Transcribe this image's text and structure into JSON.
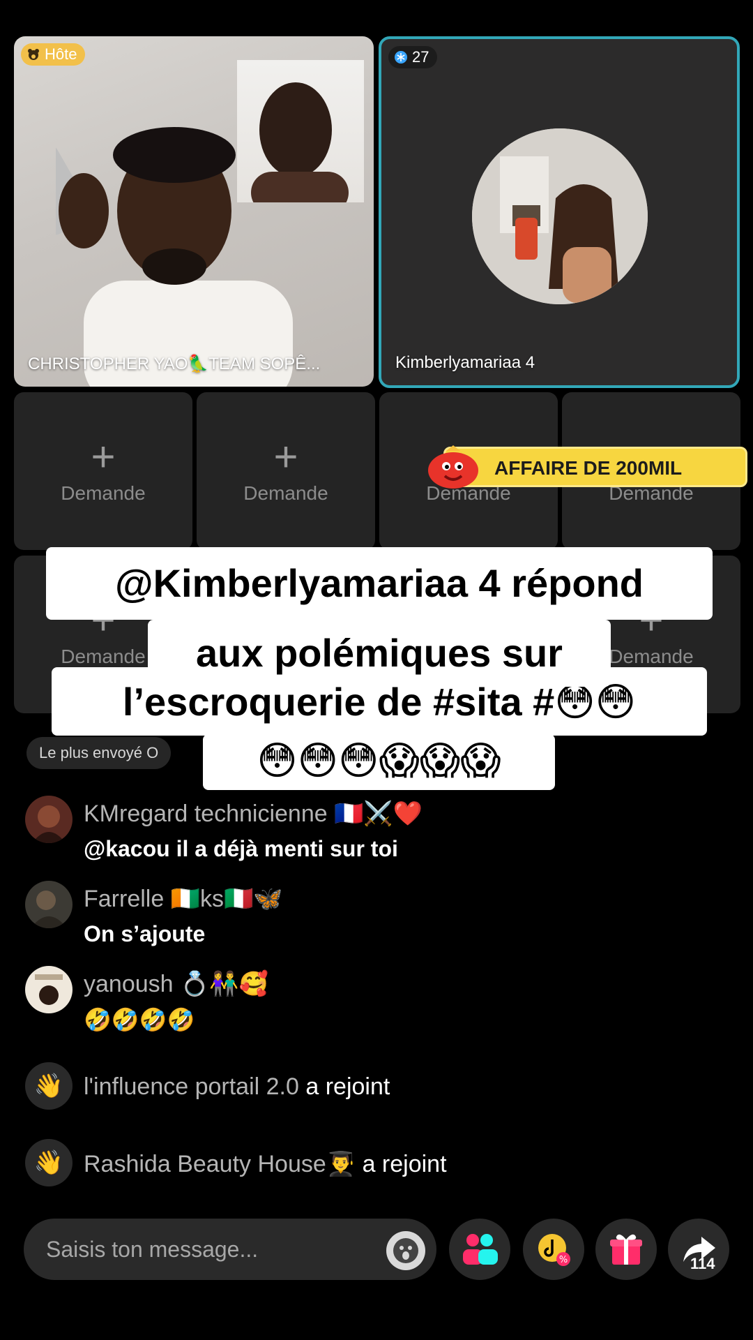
{
  "host_tile": {
    "badge": "Hôte",
    "name": "CHRISTOPHER YAO🦜TEAM SOPÊ..."
  },
  "guest_tile": {
    "badge_count": "27",
    "name": "Kimberlyamariaa 4"
  },
  "slots": {
    "label": "Demande"
  },
  "promo": {
    "label": "AFFAIRE DE 200MIL"
  },
  "caption": {
    "line1": "@Kimberlyamariaa 4 répond",
    "line2": "aux polémiques sur",
    "line3": "l’escroquerie de #sita #😳😳",
    "line4": "😳😳😳😱😱😱"
  },
  "most_sent": "Le plus envoyé O",
  "chat": {
    "messages": [
      {
        "user": "KMregard technicienne 🇫🇷⚔️❤️",
        "text": "@kacou il a déjà menti sur toi"
      },
      {
        "user": "Farrelle 🇨🇮ks🇮🇹🦋",
        "text": "On s’ajoute"
      },
      {
        "user": "yanoush 💍👫🥰",
        "text": "🤣🤣🤣🤣"
      }
    ],
    "joins": [
      {
        "name": "l'influence portail 2.0",
        "verb": "a rejoint"
      },
      {
        "name": "Rashida Beauty House👨‍🎓",
        "verb": "a rejoint"
      }
    ]
  },
  "input": {
    "placeholder": "Saisis ton message..."
  },
  "share_count": "114",
  "icons": {
    "host_badge": "bear-icon",
    "guest_badge": "snowflake-icon",
    "emoji": "emoji-face-icon",
    "guests": "add-guests-icon",
    "promo": "tiktok-coin-discount-icon",
    "gift": "gift-icon",
    "share": "share-arrow-icon",
    "join": "wave-hand-icon"
  },
  "colors": {
    "guest_border": "#32a7b8",
    "host_badge": "#f2c04a",
    "promo": "#f7d640",
    "gift": "#ff2d6a",
    "guests": "#ff2d6a"
  }
}
